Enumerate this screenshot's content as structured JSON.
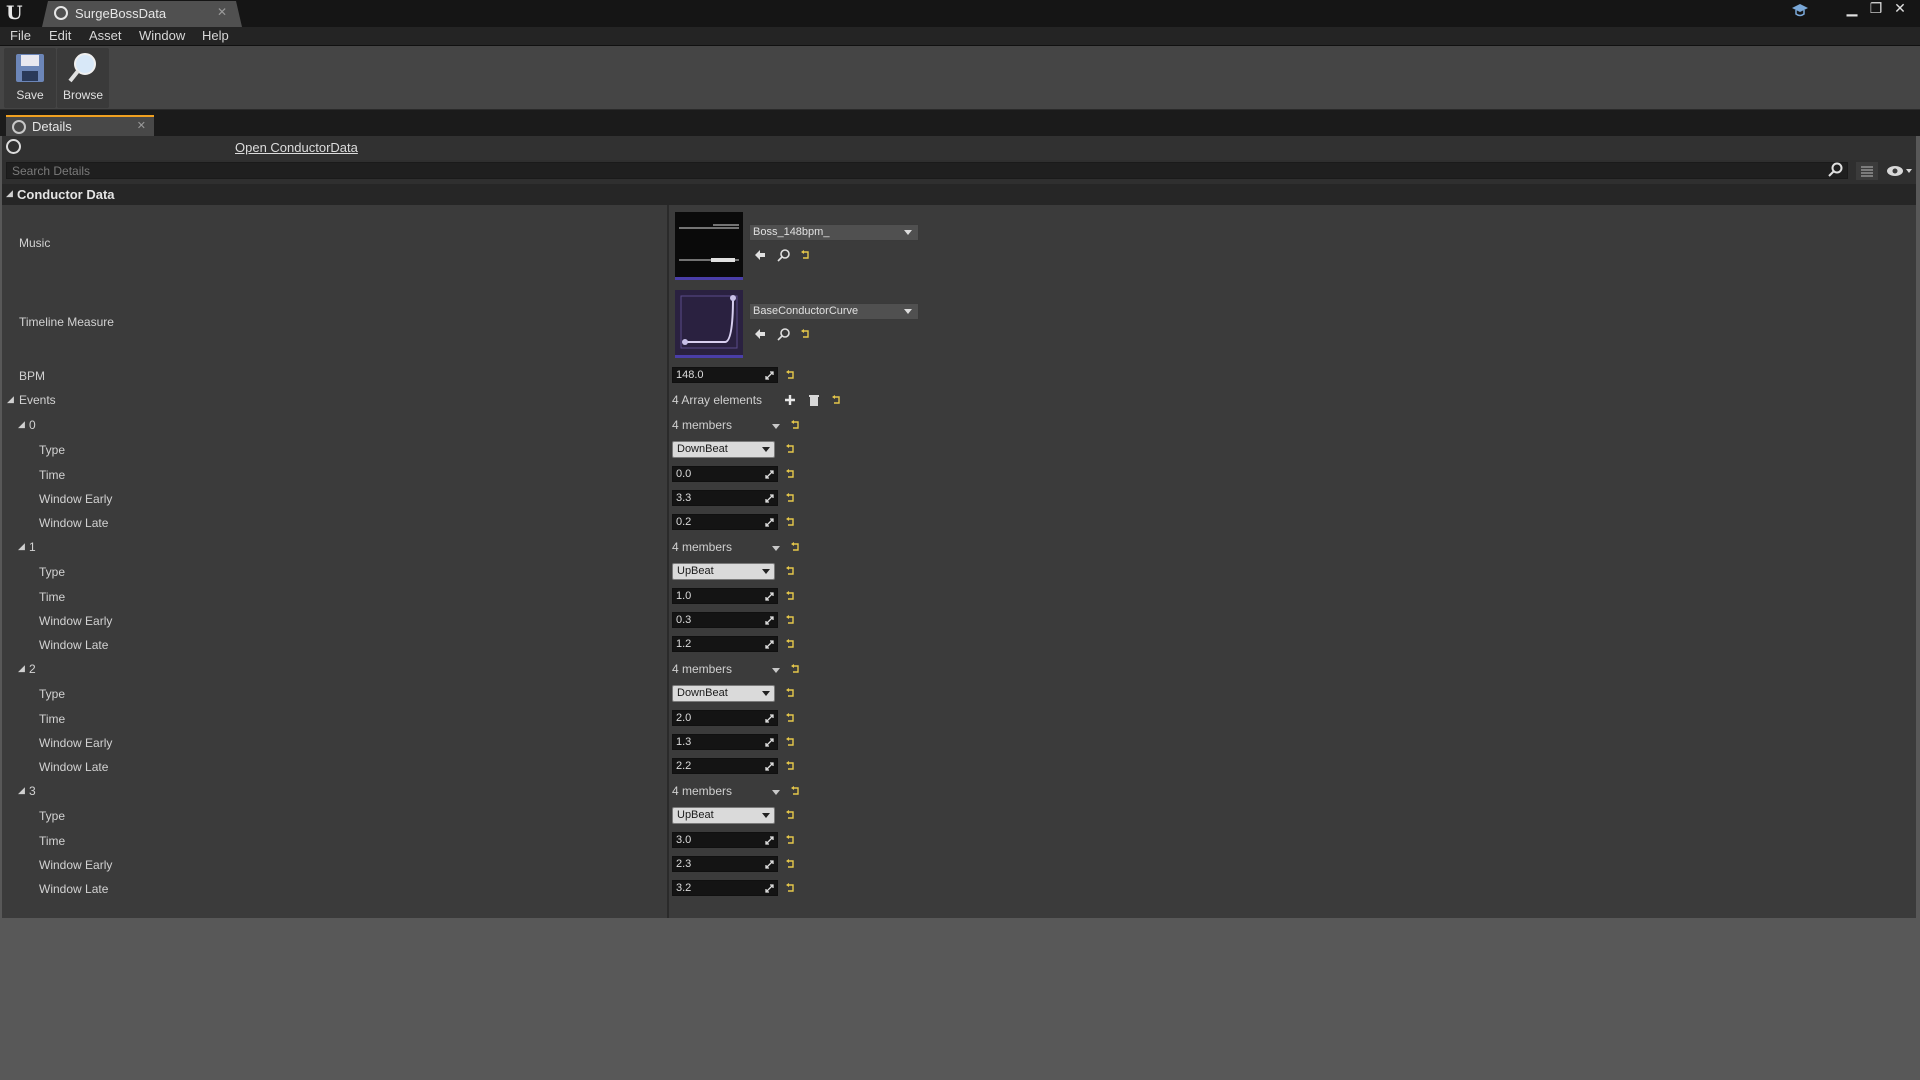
{
  "window": {
    "tab_title": "SurgeBossData"
  },
  "menu": [
    "File",
    "Edit",
    "Asset",
    "Window",
    "Help"
  ],
  "toolbar": {
    "save_label": "Save",
    "browse_label": "Browse"
  },
  "panel_tab": {
    "label": "Details"
  },
  "details": {
    "open_link": "Open ConductorData",
    "search_placeholder": "Search Details",
    "category": "Conductor Data",
    "music": {
      "label": "Music",
      "asset": "Boss_148bpm_"
    },
    "timeline": {
      "label": "Timeline Measure",
      "asset": "BaseConductorCurve"
    },
    "bpm": {
      "label": "BPM",
      "value": "148.0"
    },
    "events": {
      "label": "Events",
      "summary": "4 Array elements",
      "items": [
        {
          "index": "0",
          "members": "4 members",
          "type": "DownBeat",
          "time": "0.0",
          "early": "3.3",
          "late": "0.2"
        },
        {
          "index": "1",
          "members": "4 members",
          "type": "UpBeat",
          "time": "1.0",
          "early": "0.3",
          "late": "1.2"
        },
        {
          "index": "2",
          "members": "4 members",
          "type": "DownBeat",
          "time": "2.0",
          "early": "1.3",
          "late": "2.2"
        },
        {
          "index": "3",
          "members": "4 members",
          "type": "UpBeat",
          "time": "3.0",
          "early": "2.3",
          "late": "3.2"
        }
      ]
    },
    "field_labels": {
      "type": "Type",
      "time": "Time",
      "early": "Window Early",
      "late": "Window Late"
    }
  },
  "colors": {
    "accent": "#f0a020",
    "reset_arrow": "#e6c84a",
    "thumb_bar": "#4a3ea8"
  }
}
